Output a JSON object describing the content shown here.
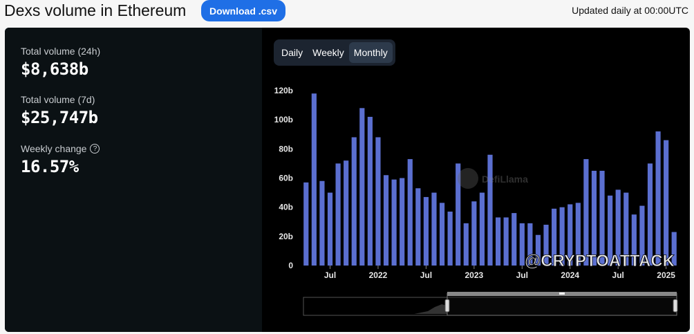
{
  "header": {
    "title": "Dexs volume in Ethereum",
    "download_label": "Download .csv",
    "updated_text": "Updated daily at 00:00UTC"
  },
  "stats": [
    {
      "label": "Total volume (24h)",
      "value": "$8,638b"
    },
    {
      "label": "Total volume (7d)",
      "value": "$25,747b"
    },
    {
      "label": "Weekly change",
      "value": "16.57%"
    }
  ],
  "period_toggle": {
    "options": [
      "Daily",
      "Weekly",
      "Monthly"
    ],
    "selected": "Monthly"
  },
  "watermarks": {
    "brand": "DefiLlama",
    "overlay": "@CRYPTOATTACK"
  },
  "colors": {
    "bar": "#5b6fd0",
    "accent_button": "#1f6fe6"
  },
  "chart_data": {
    "type": "bar",
    "ylim": [
      0,
      120
    ],
    "y_ticks": [
      "0",
      "20b",
      "40b",
      "60b",
      "80b",
      "100b",
      "120b"
    ],
    "y_tick_values": [
      0,
      20,
      40,
      60,
      80,
      100,
      120
    ],
    "x_tick_labels": [
      {
        "index": 3,
        "label": "Jul"
      },
      {
        "index": 9,
        "label": "2022"
      },
      {
        "index": 15,
        "label": "Jul"
      },
      {
        "index": 21,
        "label": "2023"
      },
      {
        "index": 27,
        "label": "Jul"
      },
      {
        "index": 33,
        "label": "2024"
      },
      {
        "index": 39,
        "label": "Jul"
      },
      {
        "index": 45,
        "label": "2025"
      }
    ],
    "values": [
      57,
      118,
      58,
      50,
      70,
      72,
      88,
      108,
      102,
      88,
      62,
      59,
      60,
      73,
      53,
      47,
      50,
      43,
      37,
      70,
      29,
      44,
      50,
      76,
      33,
      33,
      36,
      29,
      29,
      21,
      28,
      39,
      40,
      42,
      43,
      73,
      65,
      65,
      48,
      52,
      50,
      35,
      41,
      70,
      92,
      86,
      23
    ],
    "grid": false
  }
}
